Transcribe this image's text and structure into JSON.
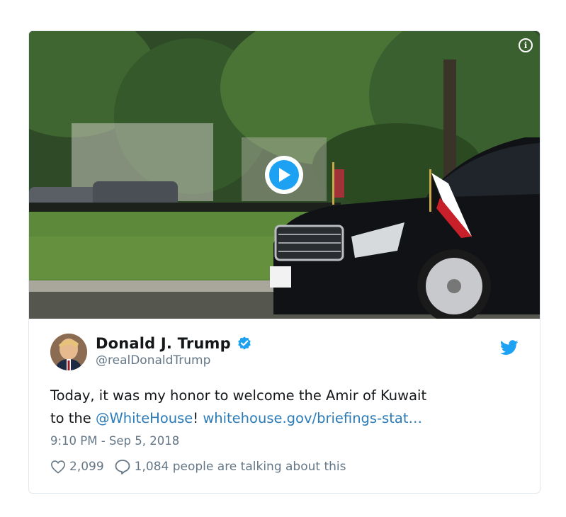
{
  "media": {
    "play_icon": "play-icon",
    "info_icon": "info-icon",
    "info_glyph": "i"
  },
  "tweet": {
    "display_name": "Donald J. Trump",
    "handle": "@realDonaldTrump",
    "verified_icon": "verified-badge-icon",
    "brand_icon": "twitter-bird-icon",
    "text_part1": "Today, it was my honor to welcome the Amir of Kuwait",
    "text_part2": "to the ",
    "mention": "@WhiteHouse",
    "text_part3": "! ",
    "link": "whitehouse.gov/briefings-stat…",
    "timestamp": "9:10 PM - Sep 5, 2018"
  },
  "actions": {
    "likes_count": "2,099",
    "talking": "1,084 people are talking about this"
  },
  "colors": {
    "brand": "#1da1f2",
    "link": "#2b7bb9",
    "text": "#14171a",
    "secondary": "#657786",
    "border": "#e1e8ed"
  }
}
